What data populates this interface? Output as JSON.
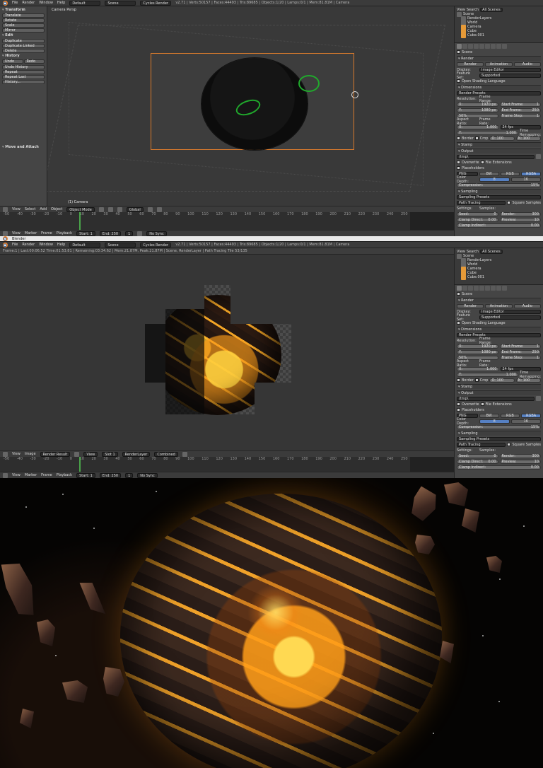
{
  "colors": {
    "ui_bg": "#454545",
    "header_bg": "#3b3b3b",
    "accent_blue": "#5680c2",
    "camera_border": "#d87a2d",
    "lava": "#f0a22a",
    "space": "#050403"
  },
  "top1": {
    "menu": [
      "File",
      "Render",
      "Window",
      "Help"
    ],
    "layout": "Default",
    "scene": "Scene",
    "engine": "Cycles Render",
    "stats": "v2.71 | Verts:50157 | Faces:44493 | Tris:89685 | Objects:1/20 | Lamps:0/1 | Mem:81.81M | Camera"
  },
  "toolshelf": {
    "transform_header": "Transform",
    "transform_buttons": [
      "Translate",
      "Rotate",
      "Scale",
      "Mirror"
    ],
    "edit_header": "Edit",
    "edit_buttons": [
      "Duplicate",
      "Duplicate Linked",
      "Delete"
    ],
    "history_header": "History",
    "history_row": [
      "Undo",
      "Redo"
    ],
    "history_buttons": [
      "Undo History",
      "Repeat",
      "Repeat Last",
      "History..."
    ],
    "operator_header": "Move and Attach"
  },
  "viewport1": {
    "label": "Camera Persp",
    "object_label": "(1) Camera"
  },
  "header3d": {
    "view": "View",
    "select": "Select",
    "add": "Add",
    "object": "Object",
    "mode": "Object Mode",
    "global": "Global"
  },
  "timeline1": {
    "ticks": [
      "-50",
      "-40",
      "-30",
      "-20",
      "-10",
      "0",
      "10",
      "20",
      "30",
      "40",
      "50",
      "60",
      "70",
      "80",
      "90",
      "100",
      "110",
      "120",
      "130",
      "140",
      "150",
      "160",
      "170",
      "180",
      "190",
      "200",
      "210",
      "220",
      "230",
      "240",
      "250",
      "260",
      "270",
      "280"
    ],
    "view": "View",
    "marker": "Marker",
    "frame": "Frame",
    "playback": "Playback",
    "start": "Start:",
    "start_value": "1",
    "end": "End:",
    "end_value": "250",
    "current": "1",
    "sync": "No Sync"
  },
  "outliner1": {
    "view": "View",
    "search": "Search",
    "scenes": "All Scenes",
    "items": [
      "Scene",
      "RenderLayers",
      "World",
      "Camera",
      "Cube",
      "Cube.001"
    ]
  },
  "properties": {
    "scene_label": "Scene",
    "render_header": "Render",
    "render_buttons": [
      "Render",
      "Animation",
      "Audio"
    ],
    "display_label": "Display:",
    "display_value": "Image Editor",
    "feature_label": "Feature Set:",
    "feature_value": "Supported",
    "osl": "Open Shading Language",
    "dimensions": "Dimensions",
    "render_presets": "Render Presets",
    "resolution": "Resolution:",
    "frame_range": "Frame Range:",
    "x_res": "1920 px",
    "y_res": "1080 px",
    "percent": "50%",
    "start_frame": "1",
    "end_frame": "250",
    "frame_step": "1",
    "aspect": "Aspect Ratio:",
    "frame_rate": "Frame Rate:",
    "aspect_x": "1.000",
    "aspect_y": "1.000",
    "fps": "24 fps",
    "time_remap": "Time Remapping:",
    "old": "O: 100",
    "new": "N: 100",
    "border": "Border",
    "crop": "Crop",
    "stamp": "Stamp",
    "output": "Output",
    "output_path": "/tmp\\",
    "overwrite": "Overwrite",
    "file_ext": "File Extensions",
    "placeholders": "Placeholders",
    "format": "PNG",
    "bw": "BW",
    "rgb": "RGB",
    "rgba": "RGBA",
    "color_depth": "Color Depth:",
    "depth8": "8",
    "depth16": "16",
    "compression": "Compression:",
    "compression_value": "15%",
    "sampling": "Sampling",
    "sampling_presets": "Sampling Presets",
    "path_tracing": "Path Tracing",
    "square_samples": "Square Samples",
    "settings": "Settings:",
    "samples": "Samples:",
    "seed": "Seed:",
    "seed_value": "0",
    "render_samples": "Render:",
    "render_samples_value": "300",
    "clamp_direct": "Clamp Direct:",
    "clamp_direct_value": "0.00",
    "preview": "Preview:",
    "preview_value": "10",
    "clamp_indirect": "Clamp Indirect:",
    "clamp_indirect_value": "0.00"
  },
  "window2": {
    "title": "Blender",
    "status": "Frame:1 | Last:00:06.52 Time:01:53.81 | Remaining:03:34.62 | Mem:21.87M, Peak:21.87M | Scene, RenderLayer | Path Tracing Tile 53/135",
    "image_menu": [
      "View",
      "Image"
    ],
    "render_result": "Render Result",
    "slot": "Slot 1",
    "layer": "RenderLayer",
    "pass": "Combined"
  },
  "timeline2": {
    "current": "1",
    "sync": "No Sync"
  }
}
